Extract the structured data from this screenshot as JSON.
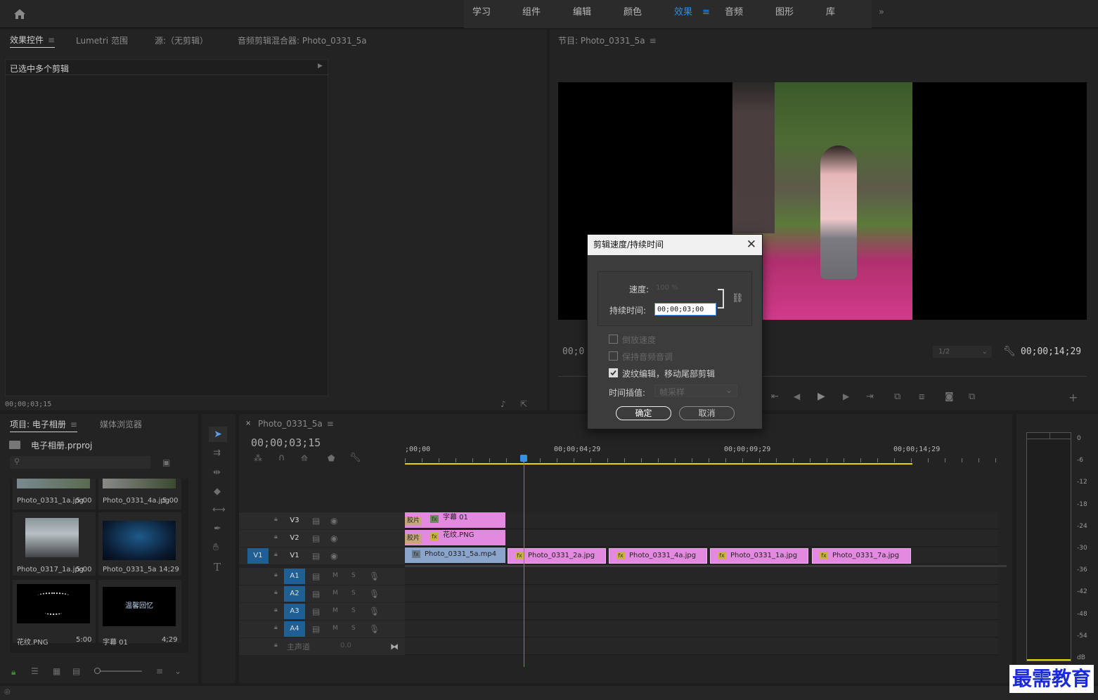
{
  "workspace": {
    "tabs": [
      "学习",
      "组件",
      "编辑",
      "颜色",
      "效果",
      "音频",
      "图形",
      "库"
    ],
    "active": "效果",
    "overflow": "»"
  },
  "source_panel": {
    "tabs": [
      "效果控件",
      "Lumetri 范围",
      "源:（无剪辑）",
      "音频剪辑混合器: Photo_0331_5a"
    ],
    "selection_label": "已选中多个剪辑",
    "timecode": "00;00;03;15"
  },
  "program": {
    "tab": "节目: Photo_0331_5a",
    "timecode_left": "00;0",
    "resolution": "1/2",
    "timecode_right": "00;00;14;29"
  },
  "dialog": {
    "title": "剪辑速度/持续时间",
    "speed_label": "速度:",
    "speed_value": "100 %",
    "duration_label": "持续时间:",
    "duration_value": "00;00;03;00",
    "reverse_label": "倒放速度",
    "keep_pitch_label": "保持音频音调",
    "ripple_label": "波纹编辑，移动尾部剪辑",
    "interp_label": "时间插值:",
    "interp_value": "帧采样",
    "ok": "确定",
    "cancel": "取消",
    "ripple_checked": true
  },
  "project": {
    "tabs": [
      "项目: 电子相册",
      "媒体浏览器"
    ],
    "file": "电子相册.prproj",
    "items": [
      {
        "name": "Photo_0331_1a.jpg",
        "dur": "5:00"
      },
      {
        "name": "Photo_0331_4a.jpg",
        "dur": "5:00"
      },
      {
        "name": "Photo_0317_1a.jpg",
        "dur": "5:00"
      },
      {
        "name": "Photo_0331_5a",
        "dur": "14;29"
      },
      {
        "name": "花纹.PNG",
        "dur": "5:00"
      },
      {
        "name": "字幕 01",
        "dur": "4;29"
      }
    ],
    "thumb_text": "温馨回忆"
  },
  "timeline": {
    "tab": "Photo_0331_5a",
    "timecode": "00;00;03;15",
    "ruler": [
      ";00;00",
      "00;00;04;29",
      "00;00;09;29",
      "00;00;14;29"
    ],
    "video_tracks": [
      "V3",
      "V2",
      "V1"
    ],
    "source_patch": "V1",
    "audio_tracks": [
      "A1",
      "A2",
      "A3",
      "A4"
    ],
    "master_label": "主声道",
    "master_value": "0.0",
    "clips": {
      "v3": {
        "badge": "胶片",
        "name": "字幕 01"
      },
      "v2": {
        "badge": "胶片",
        "name": "花纹.PNG"
      },
      "v1": [
        "Photo_0331_5a.mp4",
        "Photo_0331_2a.jpg",
        "Photo_0331_4a.jpg",
        "Photo_0331_1a.jpg",
        "Photo_0331_7a.jpg"
      ]
    }
  },
  "meter": {
    "labels": [
      "0",
      "-6",
      "-12",
      "-18",
      "-24",
      "-30",
      "-36",
      "-42",
      "-48",
      "-54",
      "dB"
    ]
  },
  "watermark": "最需教育"
}
